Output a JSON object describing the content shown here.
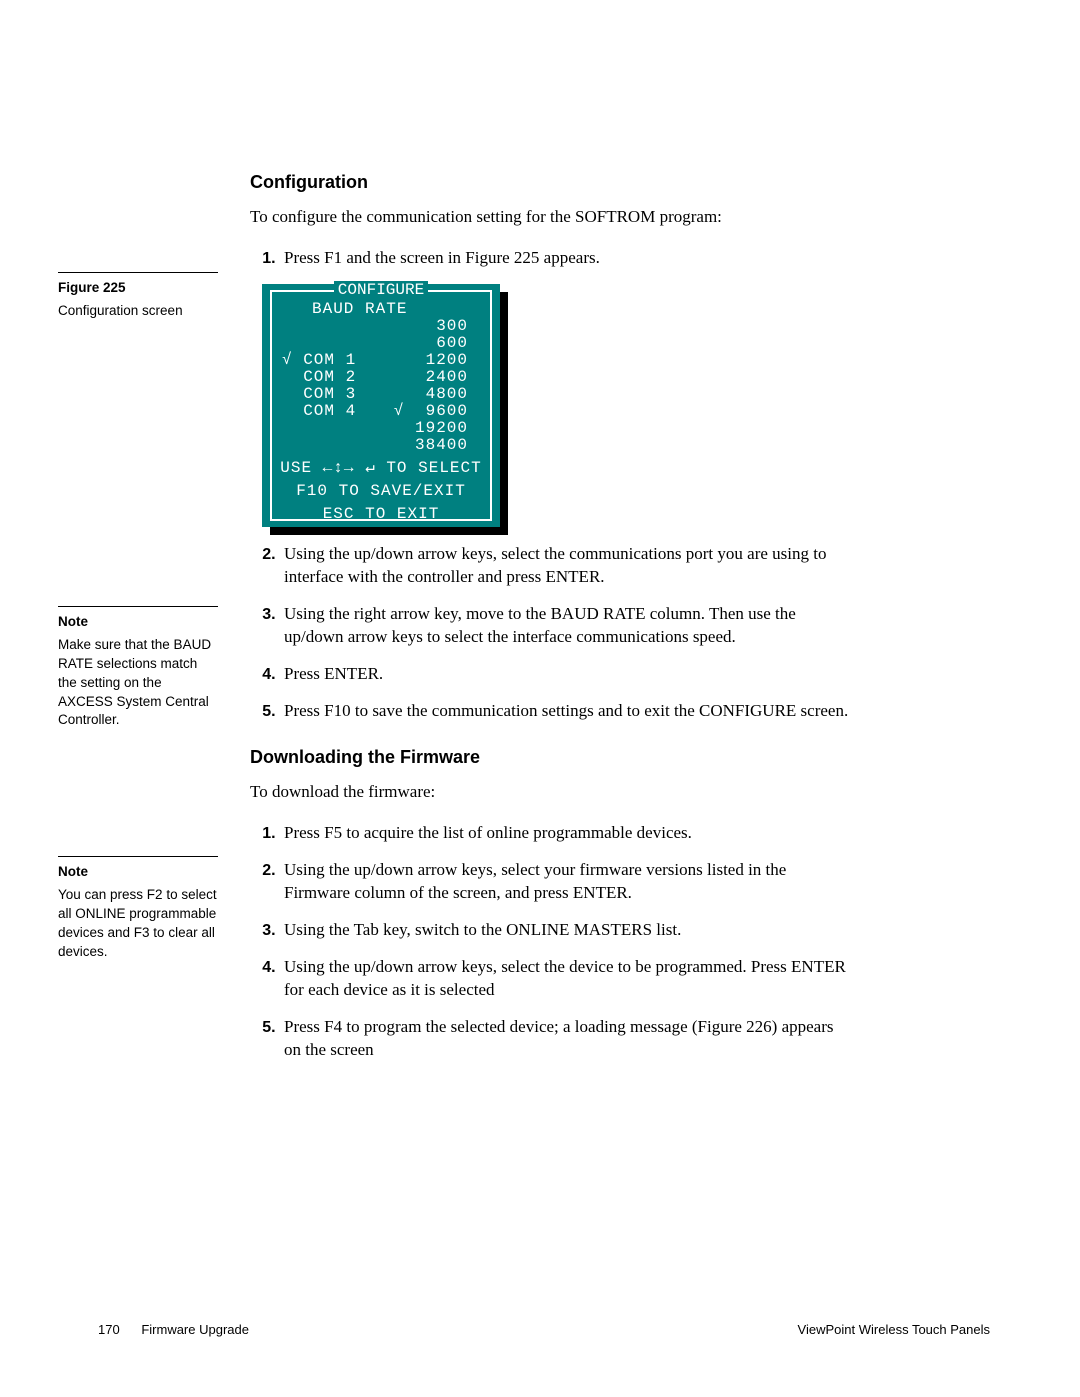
{
  "sections": {
    "config_heading": "Configuration",
    "config_intro": "To configure the communication setting for the SOFTROM program:",
    "config_steps": [
      "Press F1 and the screen in Figure 225 appears.",
      "Using the up/down arrow keys, select the communications port you are using to interface with the controller and press ENTER.",
      "Using the right arrow key, move to the BAUD RATE column. Then use the up/down arrow keys to select the interface communications speed.",
      "Press ENTER.",
      "Press F10 to save the communication settings and to exit the CONFIGURE screen."
    ],
    "firmware_heading": "Downloading the Firmware",
    "firmware_intro": "To download the firmware:",
    "firmware_steps": [
      "Press F5 to acquire the list of online programmable devices.",
      "Using the up/down arrow keys, select your firmware versions listed in the Firmware column of the screen, and press ENTER.",
      "Using the Tab key, switch to the ONLINE MASTERS list.",
      "Using the up/down arrow keys, select the device to be programmed. Press ENTER for each device as it is selected",
      "Press F4 to program the selected device; a loading message (Figure 226) appears on the screen"
    ]
  },
  "sidebar": {
    "figure_label": "Figure 225",
    "figure_caption": "Configuration screen",
    "note1_label": "Note",
    "note1_text": "Make sure that the BAUD RATE selections match the setting on the AXCESS System Central Controller.",
    "note2_label": "Note",
    "note2_text": "You can press F2 to select all ONLINE programmable devices and F3 to clear all devices."
  },
  "configure_screen": {
    "title": "CONFIGURE",
    "subtitle": "BAUD RATE",
    "com_ports": [
      "COM 1",
      "COM 2",
      "COM 3",
      "COM 4"
    ],
    "com_selected_index": 0,
    "baud_rates": [
      "300",
      "600",
      "1200",
      "2400",
      "4800",
      "9600",
      "19200",
      "38400"
    ],
    "baud_selected_index": 5,
    "hint1": "USE ←↕→  ↵ TO SELECT",
    "hint2": "F10 TO SAVE/EXIT",
    "hint3": "ESC TO EXIT"
  },
  "footer": {
    "page_number": "170",
    "section_name": "Firmware Upgrade",
    "product": "ViewPoint Wireless Touch Panels"
  }
}
